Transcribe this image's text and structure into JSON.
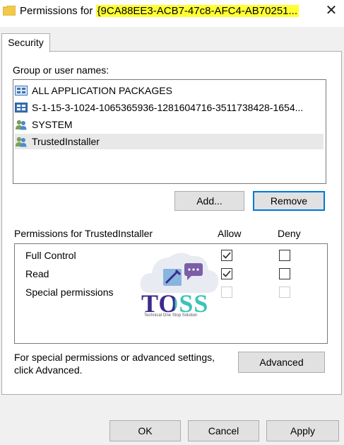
{
  "window": {
    "title_prefix": "Permissions for ",
    "title_object": "{9CA88EE3-ACB7-47c8-AFC4-AB70251...",
    "close_glyph": "✕"
  },
  "tabs": [
    {
      "label": "Security",
      "active": true
    }
  ],
  "group_section": {
    "label": "Group or user names:",
    "items": [
      {
        "name": "ALL APPLICATION PACKAGES",
        "icon": "app-packages-icon",
        "selected": false
      },
      {
        "name": "S-1-15-3-1024-1065365936-1281604716-3511738428-1654...",
        "icon": "app-capability-icon",
        "selected": false
      },
      {
        "name": "SYSTEM",
        "icon": "users-icon",
        "selected": false
      },
      {
        "name": "TrustedInstaller",
        "icon": "users-icon",
        "selected": true
      }
    ]
  },
  "buttons": {
    "add": "Add...",
    "remove": "Remove",
    "advanced": "Advanced",
    "ok": "OK",
    "cancel": "Cancel",
    "apply": "Apply"
  },
  "permissions": {
    "header": "Permissions for TrustedInstaller",
    "allow_header": "Allow",
    "deny_header": "Deny",
    "rows": [
      {
        "name": "Full Control",
        "allow": true,
        "deny": false,
        "enabled": true
      },
      {
        "name": "Read",
        "allow": true,
        "deny": false,
        "enabled": true
      },
      {
        "name": "Special permissions",
        "allow": false,
        "deny": false,
        "enabled": false
      }
    ]
  },
  "advanced_note": {
    "line1": "For special permissions or advanced settings,",
    "line2": "click Advanced."
  },
  "watermark": {
    "text": "TOSS",
    "subtitle": "Technical One Stop Solution",
    "colors": {
      "T": "#3d2a8c",
      "O": "#3d2a8c",
      "S1": "#3cc3b8",
      "S2": "#3cc3b8"
    }
  },
  "colors": {
    "title_highlight": "#ffff33",
    "focus_border": "#0078d7",
    "dialog_bg": "#f0f0f0"
  }
}
